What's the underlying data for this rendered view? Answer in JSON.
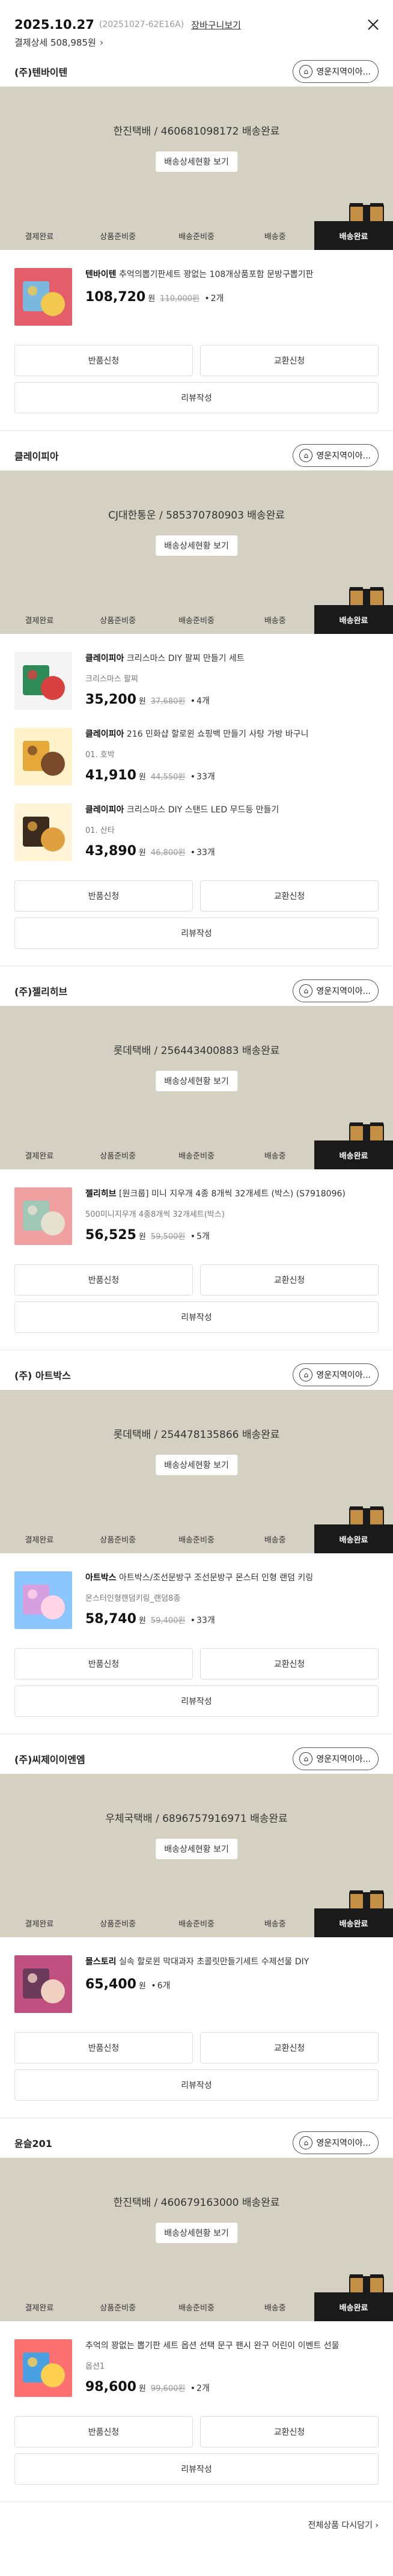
{
  "header": {
    "date": "2025.10.27",
    "order_no": "(20251027-62E16A)",
    "cart_label": "장바구니보기",
    "payment_label": "결제상세 508,985원",
    "chevron": "›"
  },
  "common": {
    "shop_button": "영운지역이아...",
    "detail_button": "배송상세현황 보기",
    "steps": [
      "결제완료",
      "상품준비중",
      "배송준비중",
      "배송중",
      "배송완료"
    ],
    "return_button": "반품신청",
    "exchange_button": "교환신청",
    "review_button": "리뷰작성",
    "won": "원",
    "dot": "•"
  },
  "sellers": [
    {
      "name": "(주)텐바이텐",
      "tracking": "한진택배 / 460681098172 배송완료",
      "items": [
        {
          "brand": "텐바이텐",
          "title": "추억의뽑기판세트 꽝없는 108개상품포함 문방구뽑기판",
          "option": "",
          "price": "108,720",
          "original": "110,000원",
          "qty": "2개"
        }
      ]
    },
    {
      "name": "클레이피아",
      "tracking": "CJ대한통운 / 585370780903 배송완료",
      "items": [
        {
          "brand": "클레이피아",
          "title": "크리스마스 DIY 팔찌 만들기 세트",
          "option": "크리스마스 팔찌",
          "price": "35,200",
          "original": "37,680원",
          "qty": "4개"
        },
        {
          "brand": "클레이피아",
          "title": "216 민화샵 할로윈 쇼핑백 만들기 사탕 가방 바구니",
          "option": "01. 호박",
          "price": "41,910",
          "original": "44,550원",
          "qty": "33개"
        },
        {
          "brand": "클레이피아",
          "title": "크리스마스 DIY 스탠드 LED 무드등 만들기",
          "option": "01. 산타",
          "price": "43,890",
          "original": "46,800원",
          "qty": "33개"
        }
      ]
    },
    {
      "name": "(주)젤리히브",
      "tracking": "롯데택배 / 256443400883 배송완료",
      "items": [
        {
          "brand": "젤리히브",
          "title": "[원크룹] 미니 지우개 4종 8개씩 32개세트 (박스) (S7918096)",
          "option": "500미니지우개 4종8개씩 32개세트(박스)",
          "price": "56,525",
          "original": "59,500원",
          "qty": "5개"
        }
      ]
    },
    {
      "name": "(주) 아트박스",
      "tracking": "롯데택배 / 254478135866 배송완료",
      "items": [
        {
          "brand": "아트박스",
          "title": "아트박스/조선문방구 조선문방구 몬스터 인형 랜덤 키링",
          "option": "몬스터인형랜덤키링_랜덤8종",
          "price": "58,740",
          "original": "59,400원",
          "qty": "33개"
        }
      ]
    },
    {
      "name": "(주)씨제이이엔엠",
      "tracking": "우체국택배 / 6896757916971 배송완료",
      "items": [
        {
          "brand": "몰스토리",
          "title": "실속 할로윈 막대과자 초콜릿만들기세트 수제선물 DIY",
          "option": "",
          "price": "65,400",
          "original": "",
          "qty": "6개"
        }
      ]
    },
    {
      "name": "윤슬201",
      "tracking": "한진택배 / 460679163000 배송완료",
      "items": [
        {
          "brand": "",
          "title": "추억의 꽝없는 뽑기판 세트 옵션 선택 문구 팬시 완구 어린이 이벤트 선물",
          "option": "옵션1",
          "price": "98,600",
          "original": "99,600원",
          "qty": "2개"
        }
      ]
    }
  ],
  "footer": {
    "reorder_label": "전체상품 다시담기 ›"
  },
  "colors": {
    "tracking_bg": "#d4d0c2",
    "active_step": "#1a1a1a",
    "box_brown": "#b8863b"
  },
  "icons": [
    "close-icon",
    "location-pin-icon",
    "delivery-box-icon",
    "chevron-right-icon"
  ]
}
